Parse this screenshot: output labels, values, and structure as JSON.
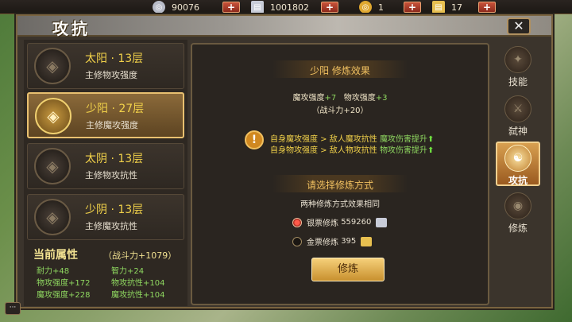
{
  "resources": [
    {
      "icon": "silver-coin-icon",
      "value": "90076"
    },
    {
      "icon": "silver-ticket-icon",
      "value": "1001802"
    },
    {
      "icon": "gold-coin-icon",
      "value": "1"
    },
    {
      "icon": "gold-ticket-icon",
      "value": "17"
    }
  ],
  "window": {
    "title": "攻抗",
    "close": "✕"
  },
  "cards": [
    {
      "name": "太阳 · 13层",
      "desc": "主修物攻强度",
      "selected": false
    },
    {
      "name": "少阳 · 27层",
      "desc": "主修魔攻强度",
      "selected": true
    },
    {
      "name": "太阴 · 13层",
      "desc": "主修物攻抗性",
      "selected": false
    },
    {
      "name": "少阴 · 13层",
      "desc": "主修魔攻抗性",
      "selected": false
    }
  ],
  "current": {
    "title": "当前属性",
    "power": "（战斗力+1079）",
    "stats": [
      {
        "label": "耐力",
        "value": "+48"
      },
      {
        "label": "智力",
        "value": "+24"
      },
      {
        "label": "物攻强度",
        "value": "+172"
      },
      {
        "label": "物攻抗性",
        "value": "+104"
      },
      {
        "label": "魔攻强度",
        "value": "+228"
      },
      {
        "label": "魔攻抗性",
        "value": "+104"
      }
    ]
  },
  "effect": {
    "title": "少阳 修炼效果",
    "line1a": "魔攻强度",
    "line1av": "+7",
    "line1b": "物攻强度",
    "line1bv": "+3",
    "power": "（战斗力+20）",
    "cond1a": "自身魔攻强度 > 敌人魔攻抗性",
    "cond1b": "魔攻伤害提升",
    "cond2a": "自身物攻强度 > 敌人物攻抗性",
    "cond2b": "物攻伤害提升"
  },
  "method": {
    "title": "请选择修炼方式",
    "note": "两种修炼方式效果相同",
    "options": [
      {
        "label": "银票修炼",
        "value": "559260",
        "selected": true
      },
      {
        "label": "金票修炼",
        "value": "395",
        "selected": false
      }
    ],
    "button": "修炼"
  },
  "tabs": [
    {
      "label": "技能",
      "active": false
    },
    {
      "label": "弑神",
      "active": false
    },
    {
      "label": "攻抗",
      "active": true
    },
    {
      "label": "修炼",
      "active": false
    }
  ],
  "colors": {
    "accent": "#f2d24a",
    "green": "#8fd860",
    "button": "#e0b050"
  }
}
